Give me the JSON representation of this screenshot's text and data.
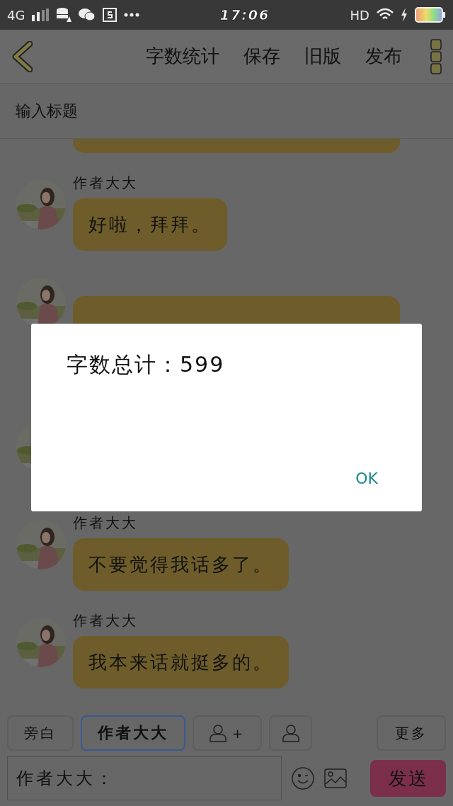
{
  "status_bar": {
    "network": "4G",
    "time": "17:06",
    "hd": "HD"
  },
  "nav": {
    "items": [
      "字数统计",
      "保存",
      "旧版",
      "发布"
    ]
  },
  "title_field": {
    "placeholder": "输入标题"
  },
  "messages": [
    {
      "kind": "cut"
    },
    {
      "kind": "message",
      "name": "作者大大",
      "text": "好啦，拜拜。"
    },
    {
      "kind": "covered-tall"
    },
    {
      "kind": "covered"
    },
    {
      "kind": "message",
      "name": "作者大大",
      "text": "不要觉得我话多了。"
    },
    {
      "kind": "message",
      "name": "作者大大",
      "text": "我本来话就挺多的。"
    }
  ],
  "roles": [
    {
      "kind": "text",
      "label": "旁白",
      "selected": false
    },
    {
      "kind": "text",
      "label": "作者大大",
      "selected": true
    },
    {
      "kind": "add-role",
      "label": "+",
      "selected": false
    },
    {
      "kind": "role",
      "selected": false
    }
  ],
  "more_button": "更多",
  "composer": {
    "value": "作者大大：",
    "send": "发送"
  },
  "dialog": {
    "message": "字数总计：599",
    "ok": "OK"
  }
}
